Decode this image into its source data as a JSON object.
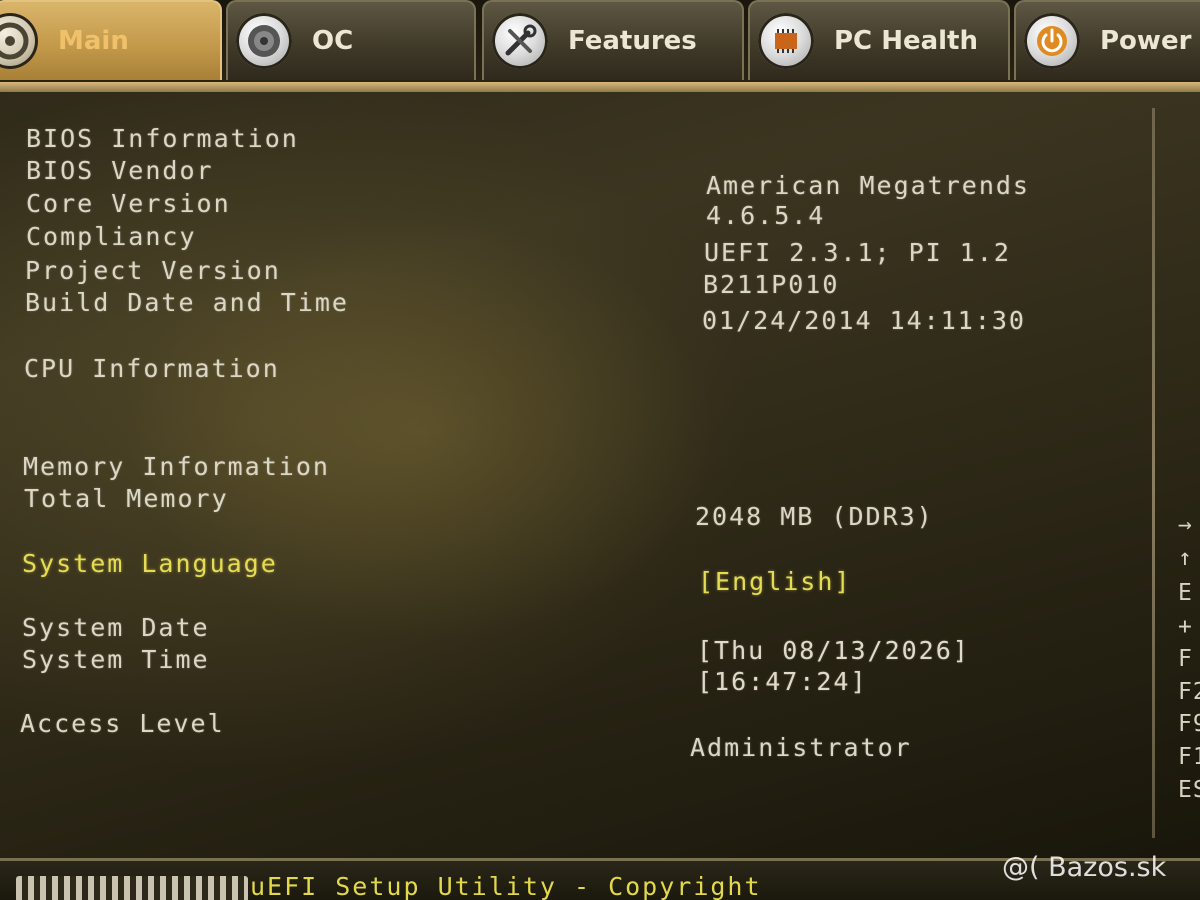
{
  "tabs": [
    {
      "label": "Main",
      "icon": "main-disc-icon",
      "active": true
    },
    {
      "label": "OC",
      "icon": "oc-gauge-icon",
      "active": false
    },
    {
      "label": "Features",
      "icon": "tools-icon",
      "active": false
    },
    {
      "label": "PC Health",
      "icon": "chip-icon",
      "active": false
    },
    {
      "label": "Power",
      "icon": "power-icon",
      "active": false
    }
  ],
  "bios": {
    "heading": "BIOS Information",
    "vendor_label": "BIOS Vendor",
    "vendor_value": "American Megatrends",
    "core_label": "Core Version",
    "core_value": "4.6.5.4",
    "compliancy_label": "Compliancy",
    "compliancy_value": "UEFI 2.3.1; PI 1.2",
    "project_label": "Project Version",
    "project_value": "B211P010",
    "build_label": "Build Date and Time",
    "build_value": "01/24/2014 14:11:30"
  },
  "cpu": {
    "heading": "CPU Information"
  },
  "memory": {
    "heading": "Memory Information",
    "total_label": "Total Memory",
    "total_value": "2048 MB (DDR3)"
  },
  "system": {
    "language_label": "System Language",
    "language_value": "[English]",
    "date_label": "System Date",
    "date_value": "[Thu 08/13/2026]",
    "time_label": "System Time",
    "time_value": "[16:47:24]",
    "access_label": "Access Level",
    "access_value": "Administrator"
  },
  "help_keys": [
    "→",
    "↑",
    "E",
    "+",
    "F",
    "F2",
    "F9",
    "F1",
    "ES"
  ],
  "footer": {
    "text": "uEFI Setup Utility - Copyright"
  },
  "watermark": "@( Bazos.sk"
}
